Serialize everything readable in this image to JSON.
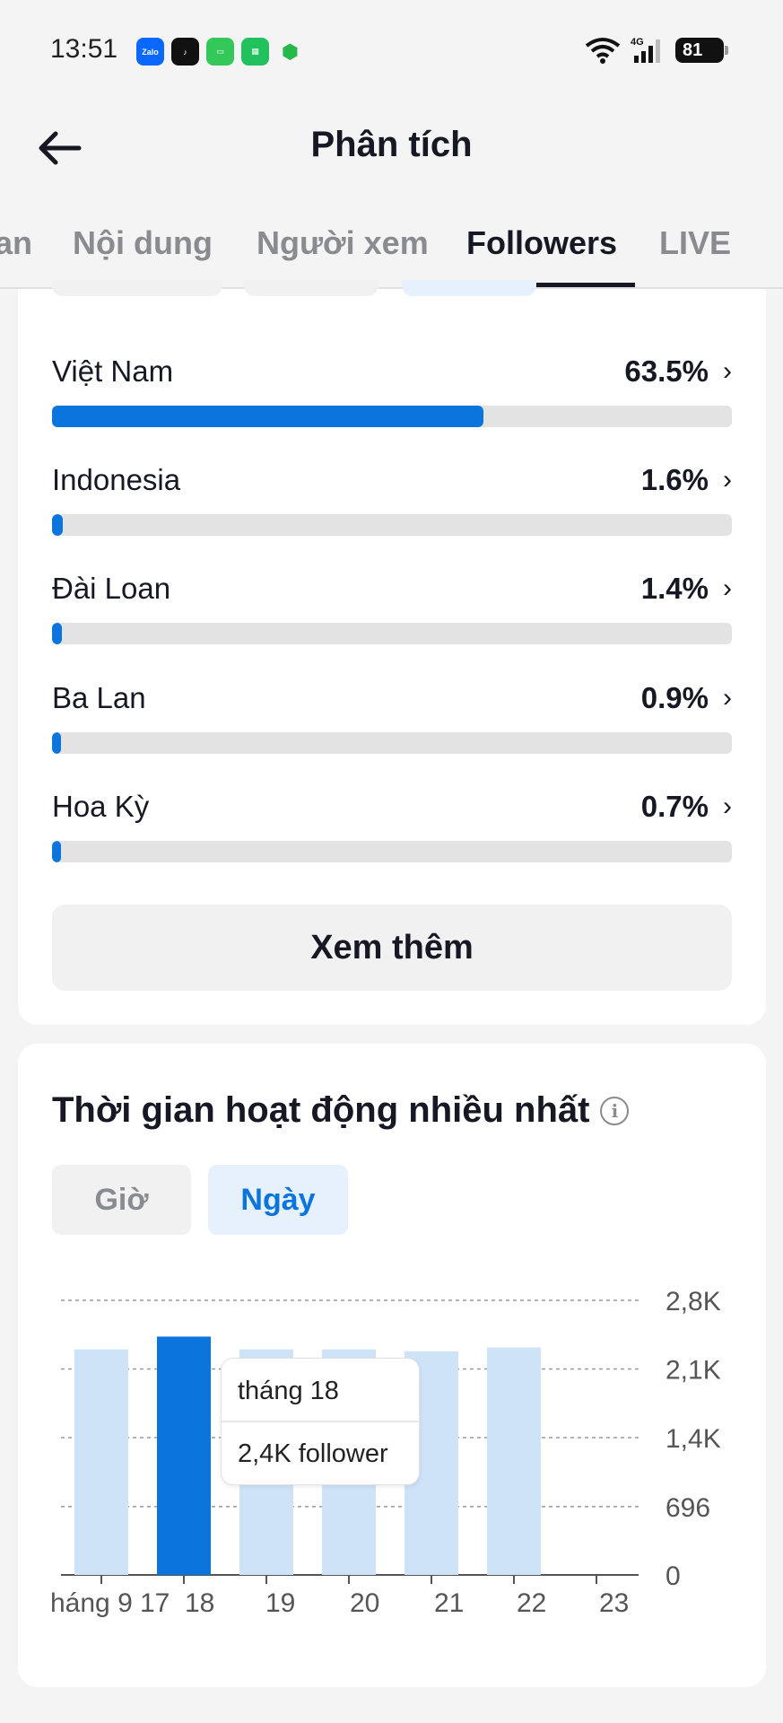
{
  "status_bar": {
    "time": "13:51",
    "battery": "81",
    "network": "4G",
    "app_icons": [
      "zalo-icon",
      "tiktok-icon",
      "messages-icon",
      "store-icon",
      "shield-icon"
    ]
  },
  "header": {
    "title": "Phân tích"
  },
  "tabs": [
    {
      "label": "an",
      "active": false
    },
    {
      "label": "Nội dung",
      "active": false
    },
    {
      "label": "Người xem",
      "active": false
    },
    {
      "label": "Followers",
      "active": true
    },
    {
      "label": "LIVE",
      "active": false
    }
  ],
  "countries": [
    {
      "name": "Việt Nam",
      "percent": "63.5%",
      "fill": 0.635
    },
    {
      "name": "Indonesia",
      "percent": "1.6%",
      "fill": 0.016
    },
    {
      "name": "Đài Loan",
      "percent": "1.4%",
      "fill": 0.014
    },
    {
      "name": "Ba Lan",
      "percent": "0.9%",
      "fill": 0.009
    },
    {
      "name": "Hoa Kỳ",
      "percent": "0.7%",
      "fill": 0.007
    }
  ],
  "see_more_label": "Xem thêm",
  "activity": {
    "title": "Thời gian hoạt động nhiều nhất",
    "filters": {
      "hour": "Giờ",
      "day": "Ngày"
    },
    "selected_filter": "day",
    "tooltip": {
      "label": "tháng 18",
      "value": "2,4K follower"
    }
  },
  "colors": {
    "accent": "#0b75dd",
    "bar_light": "#cfe3f8",
    "track": "#e3e3e3"
  },
  "chart_data": {
    "type": "bar",
    "categories": [
      "17",
      "18",
      "19",
      "20",
      "21",
      "22",
      "23"
    ],
    "x_tick_labels": [
      "háng 9",
      "17",
      "18",
      "19",
      "20",
      "21",
      "22",
      "23"
    ],
    "values": [
      2300,
      2430,
      2300,
      2300,
      2280,
      2320,
      0
    ],
    "highlighted_index": 1,
    "y_tick_labels": [
      "2,8K",
      "2,1K",
      "1,4K",
      "696",
      "0"
    ],
    "y_ticks": [
      2800,
      2100,
      1400,
      696,
      0
    ],
    "ylim": [
      0,
      2800
    ],
    "grid": true,
    "y_axis_position": "right"
  }
}
